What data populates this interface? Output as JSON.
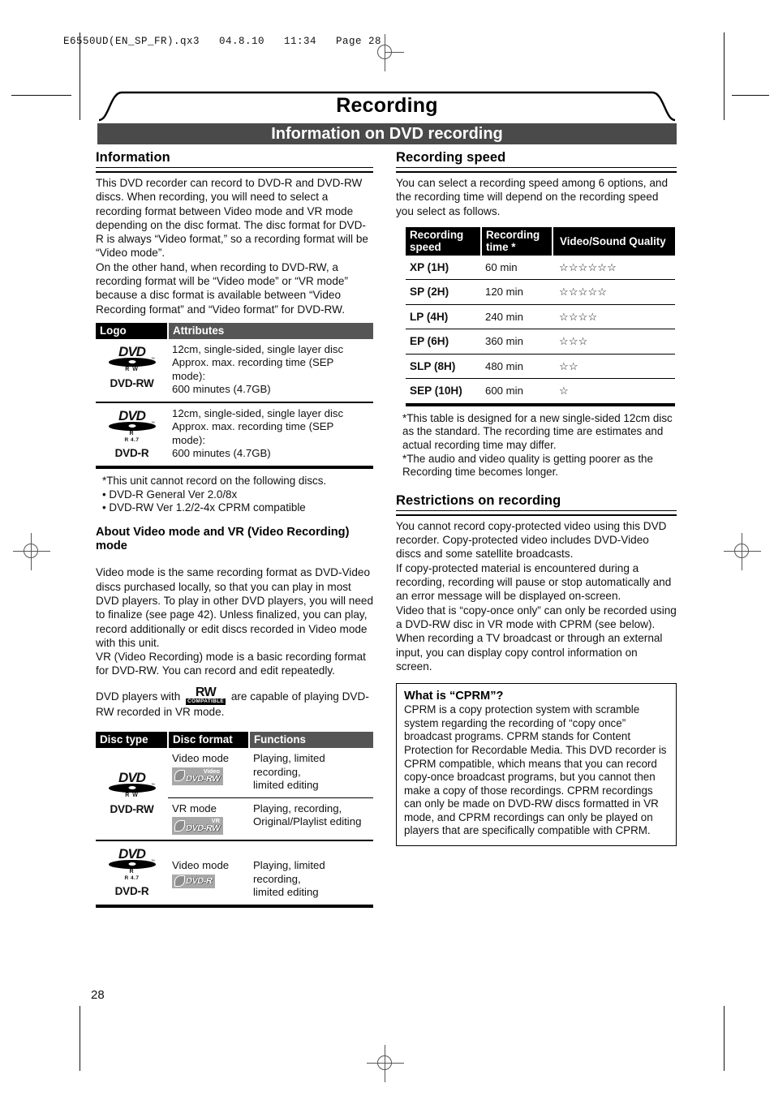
{
  "printer_marks": {
    "header_line": "E6550UD(EN_SP_FR).qx3   04.8.10   11:34   Page 28"
  },
  "page_title": "Recording",
  "section_bar": "Information on DVD recording",
  "page_number": "28",
  "left_column": {
    "heading": "Information",
    "paragraphs": [
      "This DVD recorder can record to DVD-R and DVD-RW discs. When recording, you will need to select a recording format between Video mode and VR mode depending on the disc format. The disc format for DVD-R is always “Video format,” so a recording format will be “Video mode”.",
      "On the other hand, when recording to DVD-RW, a recording format will be “Video mode” or “VR mode” because a disc format is available between “Video Recording format” and “Video format” for DVD-RW."
    ],
    "logo_table": {
      "headers": [
        "Logo",
        "Attributes"
      ],
      "rows": [
        {
          "logo_word": "DVD",
          "logo_sub1": "R W",
          "logo_sub2": "",
          "logo_caption": "DVD-RW",
          "attributes": [
            "12cm, single-sided, single layer disc",
            "Approx. max. recording time (SEP mode):",
            "600 minutes (4.7GB)"
          ]
        },
        {
          "logo_word": "DVD",
          "logo_sub1": "R",
          "logo_sub2": "R 4.7",
          "logo_caption": "DVD-R",
          "attributes": [
            "12cm, single-sided, single layer disc",
            "Approx. max. recording time (SEP mode):",
            "600 minutes (4.7GB)"
          ]
        }
      ]
    },
    "notes": [
      "*This unit cannot record on the following discs.",
      "• DVD-R General Ver 2.0/8x",
      "• DVD-RW Ver 1.2/2-4x CPRM compatible"
    ],
    "subheading2_line1": "About Video mode and VR (Video Recording)",
    "subheading2_line2": "mode",
    "paragraphs2": [
      "Video mode is the same recording format as DVD-Video discs purchased locally, so that you can play in most DVD players. To play in other DVD players, you will need to finalize (see page 42). Unless finalized, you can play, record additionally or edit discs recorded in Video mode with this unit.",
      "VR (Video Recording) mode is a basic recording format for DVD-RW. You can record and edit repeatedly."
    ],
    "rw_sentence_before": "DVD players with",
    "rw_logo_top": "RW",
    "rw_logo_bottom": "COMPATIBLE",
    "rw_sentence_after": "are capable of playing DVD-RW recorded in VR mode.",
    "disc_table": {
      "headers": [
        "Disc type",
        "Disc format",
        "Functions"
      ],
      "rows": [
        {
          "logo_word": "DVD",
          "logo_sub1": "R W",
          "logo_sub2": "",
          "logo_caption": "DVD-RW",
          "formats": [
            {
              "mode": "Video mode",
              "badge_top": "Video",
              "badge_main": "DVD-RW",
              "functions": [
                "Playing, limited recording,",
                "limited editing"
              ]
            },
            {
              "mode": "VR mode",
              "badge_top": "VR",
              "badge_main": "DVD-RW",
              "functions": [
                "Playing, recording,",
                "Original/Playlist editing"
              ]
            }
          ]
        },
        {
          "logo_word": "DVD",
          "logo_sub1": "R",
          "logo_sub2": "R 4.7",
          "logo_caption": "DVD-R",
          "formats": [
            {
              "mode": "Video mode",
              "badge_top": "",
              "badge_main": "DVD-R",
              "functions": [
                "Playing, limited recording,",
                "limited editing"
              ]
            }
          ]
        }
      ]
    }
  },
  "right_column": {
    "heading": "Recording speed",
    "intro": "You can select a recording speed among 6 options, and the recording time will depend on the recording speed you select as follows.",
    "speed_table": {
      "headers": [
        "Recording speed",
        "Recording time *",
        "Video/Sound Quality"
      ],
      "header_lines": [
        [
          "Recording",
          "speed"
        ],
        [
          "Recording",
          "time *"
        ],
        [
          "Video/Sound Quality"
        ]
      ],
      "rows": [
        {
          "speed": "XP (1H)",
          "time": "60 min",
          "stars": 6
        },
        {
          "speed": "SP (2H)",
          "time": "120 min",
          "stars": 5
        },
        {
          "speed": "LP (4H)",
          "time": "240 min",
          "stars": 4
        },
        {
          "speed": "EP (6H)",
          "time": "360 min",
          "stars": 3
        },
        {
          "speed": "SLP (8H)",
          "time": "480 min",
          "stars": 2
        },
        {
          "speed": "SEP (10H)",
          "time": "600 min",
          "stars": 1
        }
      ]
    },
    "notes": [
      "*This table is designed for a new single-sided 12cm disc as the standard. The recording time are estimates and actual recording time may differ.",
      "*The audio and video quality is getting poorer as the Recording time becomes longer."
    ],
    "heading2": "Restrictions on recording",
    "paragraphs2": [
      "You cannot record copy-protected video using this DVD recorder. Copy-protected video includes DVD-Video discs and some satellite broadcasts.",
      "If copy-protected material is encountered during a recording, recording will pause or stop automatically and an error message will be displayed on-screen.",
      "Video that is “copy-once only” can only be recorded using a DVD-RW disc in VR mode with CPRM (see below).",
      "When recording a TV broadcast or through an external input, you can display copy control information on screen."
    ],
    "cprm_box": {
      "heading": "What is “CPRM”?",
      "body": "CPRM is a copy protection system with scramble system regarding the recording of “copy once” broadcast programs. CPRM stands for Content Protection for Recordable Media. This DVD recorder is CPRM compatible, which means that you can  record copy-once broadcast programs, but you cannot then make a copy of those recordings. CPRM recordings can only be made on DVD-RW discs formatted in VR mode, and CPRM recordings can only be played on players that are specifically compatible with CPRM."
    }
  },
  "colors": {
    "section_bar_bg": "#4a4a4a",
    "table_header_bg": "#000000",
    "table_header_gray": "#555555",
    "badge_bg": "#a8a8a8",
    "text": "#111111"
  }
}
